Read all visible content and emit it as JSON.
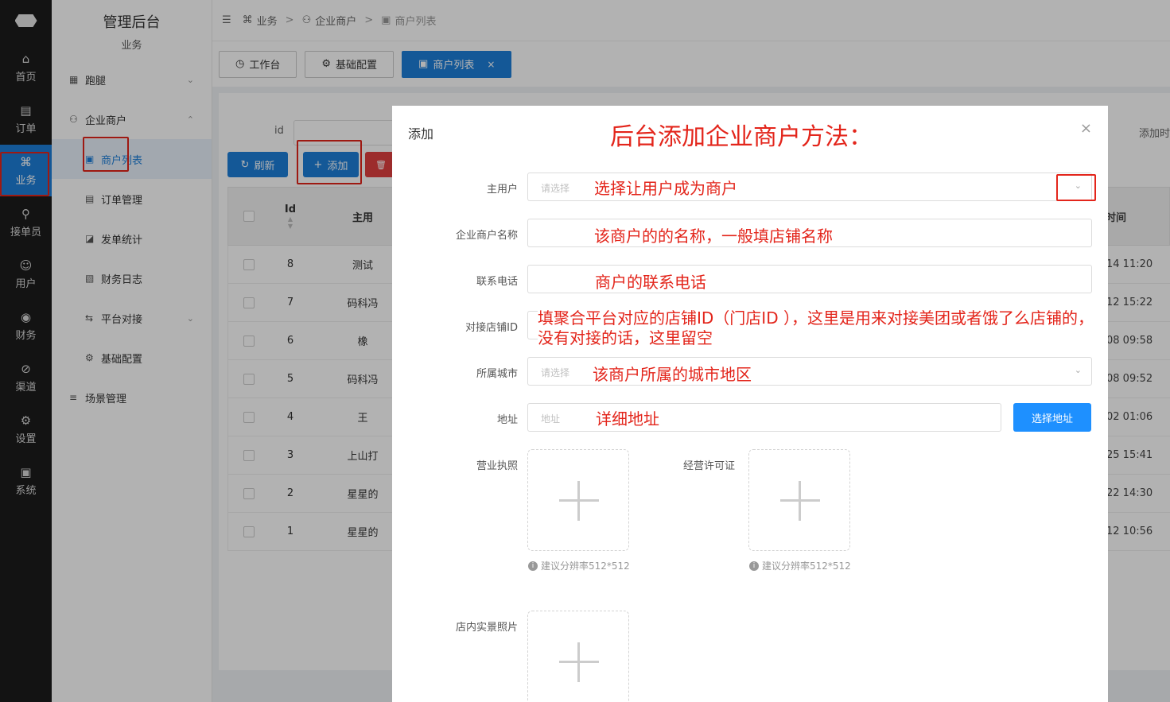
{
  "rail": {
    "items": [
      {
        "label": "首页",
        "icon": "home-icon",
        "glyph": "⌂"
      },
      {
        "label": "订单",
        "icon": "order-icon",
        "glyph": "▤"
      },
      {
        "label": "业务",
        "icon": "business-icon",
        "glyph": "⌘"
      },
      {
        "label": "接单员",
        "icon": "rider-icon",
        "glyph": "⚲"
      },
      {
        "label": "用户",
        "icon": "user-icon",
        "glyph": "☺"
      },
      {
        "label": "财务",
        "icon": "finance-icon",
        "glyph": "◉"
      },
      {
        "label": "渠道",
        "icon": "channel-icon",
        "glyph": "⊘"
      },
      {
        "label": "设置",
        "icon": "settings-icon",
        "glyph": "⚙"
      },
      {
        "label": "系统",
        "icon": "system-icon",
        "glyph": "▣"
      }
    ],
    "active_index": 2
  },
  "sidebar": {
    "title": "管理后台",
    "subtitle": "业务",
    "items": [
      {
        "label": "跑腿",
        "glyph": "▦",
        "arrow": "⌄"
      },
      {
        "label": "企业商户",
        "glyph": "⚇",
        "arrow": "⌃"
      },
      {
        "label": "商户列表",
        "glyph": "▣",
        "arrow": ""
      },
      {
        "label": "订单管理",
        "glyph": "▤",
        "arrow": ""
      },
      {
        "label": "发单统计",
        "glyph": "◪",
        "arrow": ""
      },
      {
        "label": "财务日志",
        "glyph": "▧",
        "arrow": ""
      },
      {
        "label": "平台对接",
        "glyph": "⇆",
        "arrow": "⌄"
      },
      {
        "label": "基础配置",
        "glyph": "⚙",
        "arrow": ""
      },
      {
        "label": "场景管理",
        "glyph": "≡",
        "arrow": ""
      }
    ]
  },
  "breadcrumb": {
    "menu_glyph": "☰",
    "items": [
      "业务",
      "企业商户",
      "商户列表"
    ],
    "separator": ">"
  },
  "tabs": [
    {
      "label": "工作台",
      "glyph": "◷"
    },
    {
      "label": "基础配置",
      "glyph": "⚙"
    },
    {
      "label": "商户列表",
      "glyph": "▣",
      "close": "×"
    }
  ],
  "list": {
    "filter_label": "id",
    "filter_right_label": "添加时",
    "refresh_label": "刷新",
    "add_label": "添加",
    "delete_glyph": "🗑",
    "columns": {
      "id": "Id",
      "user": "主用",
      "time": "时间"
    },
    "rows": [
      {
        "id": "8",
        "name": "测试",
        "time": "14 11:20"
      },
      {
        "id": "7",
        "name": "码科冯",
        "time": "12 15:22"
      },
      {
        "id": "6",
        "name": "橡",
        "time": "08 09:58"
      },
      {
        "id": "5",
        "name": "码科冯",
        "time": "08 09:52"
      },
      {
        "id": "4",
        "name": "王",
        "time": "02 01:06"
      },
      {
        "id": "3",
        "name": "上山打",
        "time": "25 15:41"
      },
      {
        "id": "2",
        "name": "星星的",
        "time": "22 14:30"
      },
      {
        "id": "1",
        "name": "星星的",
        "time": "12 10:56"
      }
    ]
  },
  "dialog": {
    "title": "添加",
    "close": "×",
    "heading_annotation": "后台添加企业商户方法：",
    "fields": {
      "main_user": {
        "label": "主用户",
        "placeholder": "请选择",
        "annotation": "选择让用户成为商户"
      },
      "company_name": {
        "label": "企业商户名称",
        "annotation": "该商户的的名称，一般填店铺名称"
      },
      "phone": {
        "label": "联系电话",
        "annotation": "商户的联系电话"
      },
      "store_id": {
        "label": "对接店铺ID",
        "annotation_line1": "填聚合平台对应的店铺ID（门店ID ），这里是用来对接美团或者饿了么店铺的，",
        "annotation_line2": "没有对接的话，这里留空"
      },
      "city": {
        "label": "所属城市",
        "placeholder": "请选择",
        "annotation": "该商户所属的城市地区"
      },
      "address": {
        "label": "地址",
        "placeholder": "地址",
        "annotation": "详细地址",
        "button": "选择地址"
      },
      "license": {
        "label": "营业执照",
        "hint": "建议分辨率512*512"
      },
      "permit": {
        "label": "经营许可证",
        "hint": "建议分辨率512*512"
      },
      "photos": {
        "label": "店内实景照片"
      }
    }
  }
}
